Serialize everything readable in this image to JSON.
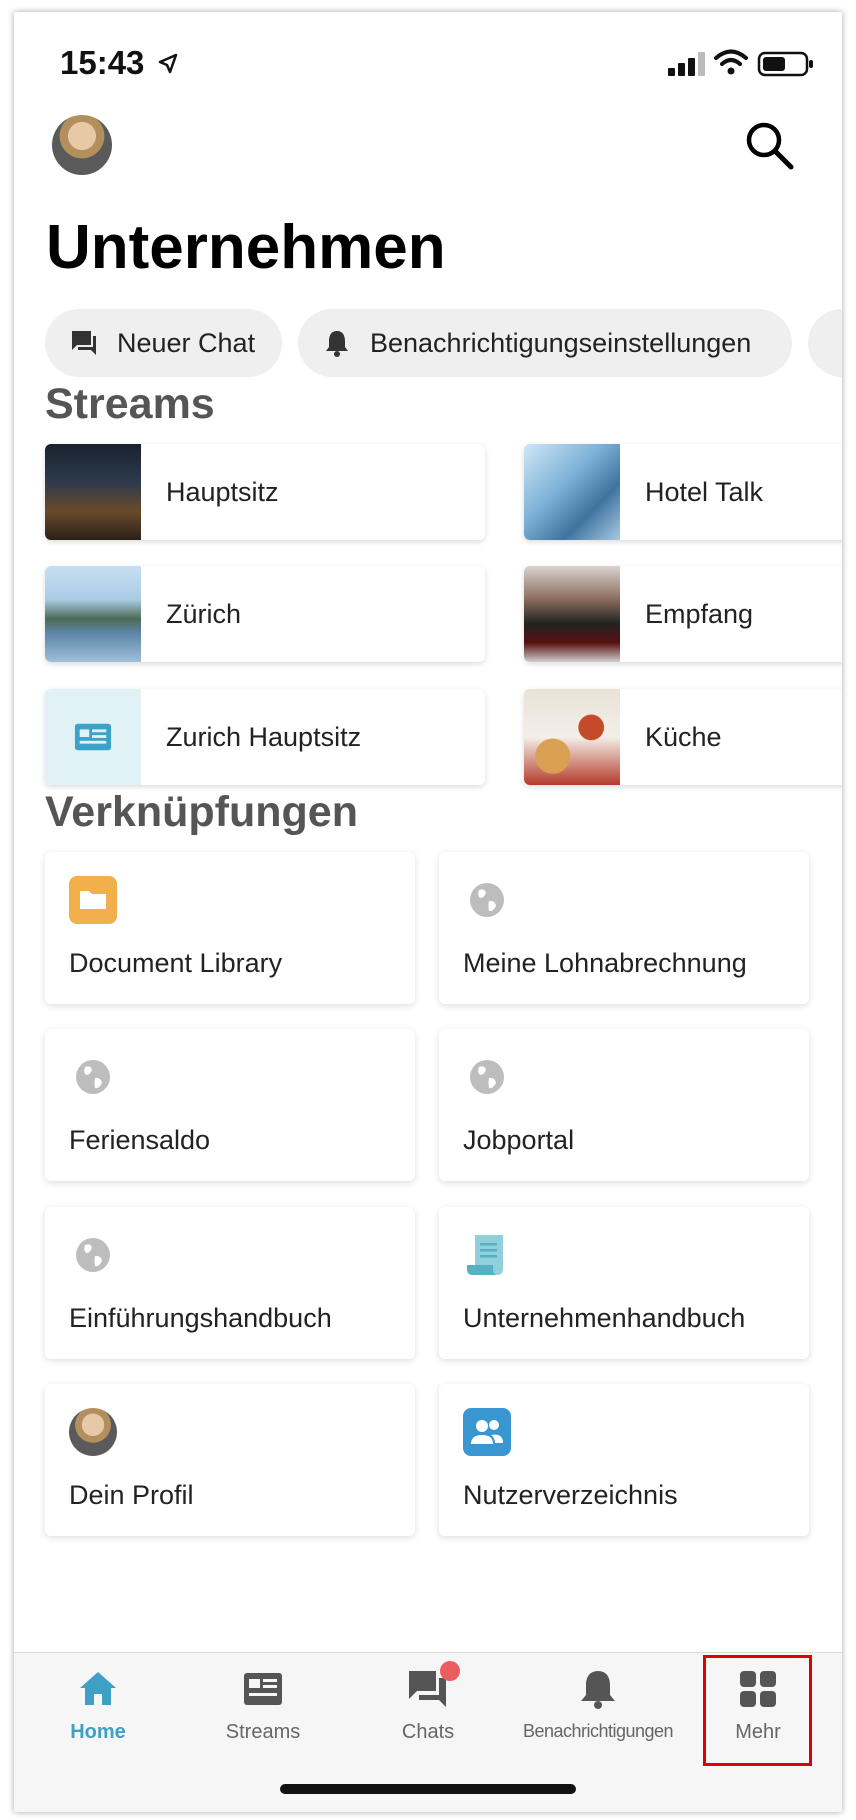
{
  "status_bar": {
    "time": "15:43"
  },
  "header": {
    "title": "Unternehmen"
  },
  "quick_actions": [
    {
      "label": "Neuer Chat",
      "icon": "chat-bubble-icon"
    },
    {
      "label": "Benachrichtigungseinstellungen",
      "icon": "bell-icon"
    }
  ],
  "streams": {
    "title": "Streams",
    "items": [
      {
        "label": "Hauptsitz"
      },
      {
        "label": "Hotel Talk"
      },
      {
        "label": "Zürich"
      },
      {
        "label": "Empfang"
      },
      {
        "label": "Zurich Hauptsitz"
      },
      {
        "label": "Küche"
      }
    ]
  },
  "shortcuts": {
    "title": "Verknüpfungen",
    "items": [
      {
        "label": "Document Library",
        "icon": "folder-icon"
      },
      {
        "label": "Meine Lohnabrechnung",
        "icon": "globe-icon"
      },
      {
        "label": "Feriensaldo",
        "icon": "globe-icon"
      },
      {
        "label": "Jobportal",
        "icon": "globe-icon"
      },
      {
        "label": "Einführungshandbuch",
        "icon": "globe-icon"
      },
      {
        "label": "Unternehmenhandbuch",
        "icon": "scroll-icon"
      },
      {
        "label": "Dein Profil",
        "icon": "avatar"
      },
      {
        "label": "Nutzerverzeichnis",
        "icon": "users-icon"
      }
    ]
  },
  "tabbar": {
    "items": [
      {
        "label": "Home"
      },
      {
        "label": "Streams"
      },
      {
        "label": "Chats"
      },
      {
        "label": "Benachrichtigungen"
      },
      {
        "label": "Mehr"
      }
    ],
    "active": "Home"
  },
  "colors": {
    "accent": "#3ea0c4",
    "badge": "#ec5d5d",
    "highlight_box": "#e00000",
    "folder": "#f2b04d",
    "users_tile": "#3a96d0"
  }
}
